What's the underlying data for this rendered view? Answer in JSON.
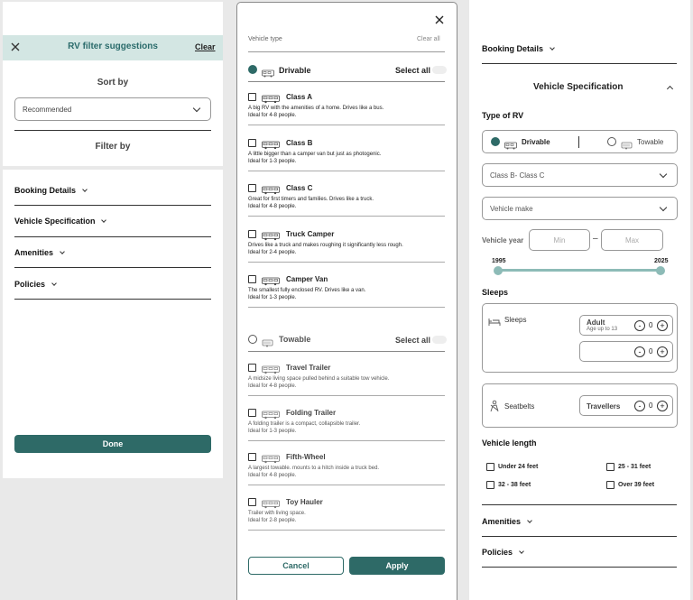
{
  "filter_panel": {
    "title": "RV filter suggestions",
    "clear_label": "Clear",
    "sort_heading": "Sort by",
    "sort_value": "Recommended",
    "filter_heading": "Filter by",
    "sections": [
      "Booking Details",
      "Vehicle Specification",
      "Amenities",
      "Policies"
    ],
    "done_label": "Done"
  },
  "vehicle_panel": {
    "header": "Vehicle type",
    "clear_all": "Clear all",
    "select_all": "Select all",
    "groups": [
      {
        "label": "Drivable",
        "selected": true,
        "items": [
          {
            "title": "Class A",
            "line1": "A big RV with the amenities of a home. Drives like a bus.",
            "line2": "Ideal for 4-8 people."
          },
          {
            "title": "Class B",
            "line1": "A little bigger than a camper van but just as photogenic.",
            "line2": "Ideal for 1-3 people."
          },
          {
            "title": "Class C",
            "line1": "Great for first timers and families. Drives like a truck.",
            "line2": "Ideal for 4-8 people."
          },
          {
            "title": "Truck Camper",
            "line1": "Drives like a truck and makes roughing it significantly less rough.",
            "line2": "Ideal for 2-4 people."
          },
          {
            "title": "Camper Van",
            "line1": "The smallest fully enclosed RV. Drives like a van.",
            "line2": "Ideal for 1-3 people."
          }
        ]
      },
      {
        "label": "Towable",
        "selected": false,
        "items": [
          {
            "title": "Travel Trailer",
            "line1": "A midsize living space pulled behind a suitable tow vehicle.",
            "line2": "Ideal for 4-8 people."
          },
          {
            "title": "Folding Trailer",
            "line1": "A folding trailer is a compact, collapsible trailer.",
            "line2": "Ideal for 1-3 people."
          },
          {
            "title": "Fifth-Wheel",
            "line1": "A largest towable. mounts to a hitch inside a truck bed.",
            "line2": "Ideal for 4-8 people."
          },
          {
            "title": "Toy Hauler",
            "line1": "Trailer with living space.",
            "line2": "Ideal for 2-8 people."
          }
        ]
      }
    ],
    "cancel_label": "Cancel",
    "apply_label": "Apply"
  },
  "spec_panel": {
    "booking_details": "Booking Details",
    "title": "Vehicle Specification",
    "type_heading": "Type of RV",
    "drivable": "Drivable",
    "towable": "Towable",
    "class_select": "Class B- Class C",
    "make_select": "Vehicle make",
    "year_label": "Vehicle year",
    "min_placeholder": "Min",
    "dash": "–",
    "max_placeholder": "Max",
    "year_min": "1995",
    "year_max": "2025",
    "sleeps_heading": "Sleeps",
    "sleeps_label": "Sleeps",
    "adult_label": "Adult",
    "adult_sub": "Age up to 13",
    "adult_count": "0",
    "child_count": "0",
    "seatbelts_label": "Seatbelts",
    "travellers_label": "Travellers",
    "travellers_count": "0",
    "minus": "-",
    "plus": "+",
    "length_heading": "Vehicle length",
    "lengths": [
      "Under 24 feet",
      "25 - 31 feet",
      "32 - 38 feet",
      "Over 39 feet"
    ],
    "amenities": "Amenities",
    "policies": "Policies"
  },
  "colors": {
    "accent": "#2e6a67",
    "header_bg": "#d3e6e3"
  }
}
